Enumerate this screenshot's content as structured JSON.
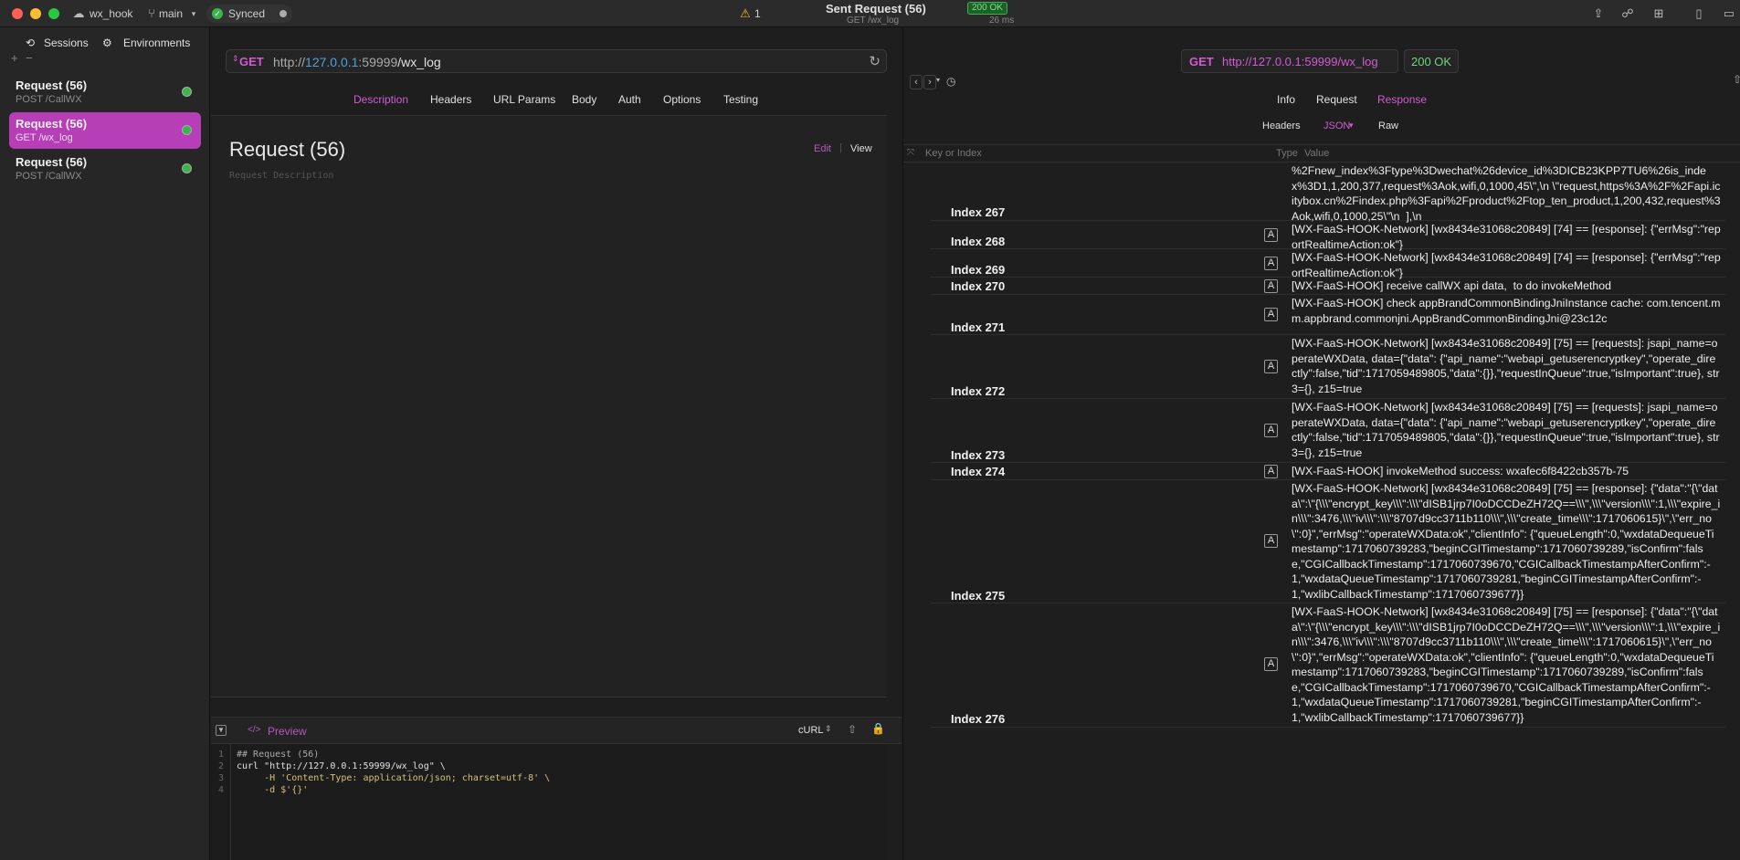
{
  "titlebar": {
    "project": "wx_hook",
    "branch": "main",
    "sync_status": "Synced",
    "warning_count": "1",
    "window_title": "Sent Request (56)",
    "window_subtitle": "GET /wx_log",
    "status_badge": "200 OK",
    "timing": "26 ms"
  },
  "sidebar": {
    "tab_sessions": "Sessions",
    "tab_environments": "Environments",
    "items": [
      {
        "title": "Request (56)",
        "subtitle": "POST /CallWX"
      },
      {
        "title": "Request (56)",
        "subtitle": "GET /wx_log"
      },
      {
        "title": "Request (56)",
        "subtitle": "POST /CallWX"
      }
    ]
  },
  "request": {
    "method": "GET",
    "url_prefix": "http://",
    "url_host": "127.0.0.1",
    "url_port": ":59999",
    "url_path": "/wx_log",
    "tabs": [
      "Description",
      "Headers",
      "URL Params",
      "Body",
      "Auth",
      "Options",
      "Testing"
    ],
    "title": "Request (56)",
    "description_placeholder": "Request Description",
    "edit_label": "Edit",
    "view_label": "View"
  },
  "preview": {
    "label": "Preview",
    "format": "cURL",
    "code_lines": [
      "## Request (56)",
      "curl \"http://127.0.0.1:59999/wx_log\" \\",
      "     -H 'Content-Type: application/json; charset=utf-8' \\",
      "     -d $'{}'"
    ]
  },
  "response": {
    "method": "GET",
    "url": "http://127.0.0.1:59999/wx_log",
    "status": "200 OK",
    "tabs": [
      "Info",
      "Request",
      "Response"
    ],
    "subtabs": [
      "Headers",
      "JSON",
      "Raw"
    ],
    "col_key_placeholder": "Key or Index",
    "col_type": "Type",
    "col_value": "Value",
    "rows": [
      {
        "index": "Index 267",
        "type": "",
        "value": "%2Fnew_index%3Ftype%3Dwechat%26device_id%3DICB23KPP7TU6%26is_index%3D1,1,200,377,request%3Aok,wifi,0,1000,45\\\",\\n \\\"request,https%3A%2F%2Fapi.icitybox.cn%2Findex.php%3Fapi%2Fproduct%2Ftop_ten_product,1,200,432,request%3Aok,wifi,0,1000,25\\\"\\n  ],\\n"
      },
      {
        "index": "Index 268",
        "type": "A",
        "value": "[WX-FaaS-HOOK-Network] [wx8434e31068c20849] [74] == [response]: {\"errMsg\":\"reportRealtimeAction:ok\"}"
      },
      {
        "index": "Index 269",
        "type": "A",
        "value": "[WX-FaaS-HOOK-Network] [wx8434e31068c20849] [74] == [response]: {\"errMsg\":\"reportRealtimeAction:ok\"}"
      },
      {
        "index": "Index 270",
        "type": "A",
        "value": "[WX-FaaS-HOOK] receive callWX api data,  to do invokeMethod"
      },
      {
        "index": "Index 271",
        "type": "A",
        "value": "[WX-FaaS-HOOK] check appBrandCommonBindingJniInstance cache: com.tencent.mm.appbrand.commonjni.AppBrandCommonBindingJni@23c12c"
      },
      {
        "index": "Index 272",
        "type": "A",
        "value": "[WX-FaaS-HOOK-Network] [wx8434e31068c20849] [75] == [requests]: jsapi_name=operateWXData, data={\"data\": {\"api_name\":\"webapi_getuserencryptkey\",\"operate_directly\":false,\"tid\":1717059489805,\"data\":{}},\"requestInQueue\":true,\"isImportant\":true}, str3={}, z15=true"
      },
      {
        "index": "Index 273",
        "type": "A",
        "value": "[WX-FaaS-HOOK-Network] [wx8434e31068c20849] [75] == [requests]: jsapi_name=operateWXData, data={\"data\": {\"api_name\":\"webapi_getuserencryptkey\",\"operate_directly\":false,\"tid\":1717059489805,\"data\":{}},\"requestInQueue\":true,\"isImportant\":true}, str3={}, z15=true"
      },
      {
        "index": "Index 274",
        "type": "A",
        "value": "[WX-FaaS-HOOK] invokeMethod success: wxafec6f8422cb357b-75"
      },
      {
        "index": "Index 275",
        "type": "A",
        "value": "[WX-FaaS-HOOK-Network] [wx8434e31068c20849] [75] == [response]: {\"data\":\"{\\\"data\\\":\\\"{\\\\\\\"encrypt_key\\\\\\\":\\\\\\\"dISB1jrp7I0oDCCDeZH72Q==\\\\\\\",\\\\\\\"version\\\\\\\":1,\\\\\\\"expire_in\\\\\\\":3476,\\\\\\\"iv\\\\\\\":\\\\\\\"8707d9cc3711b110\\\\\\\",\\\\\\\"create_time\\\\\\\":1717060615}\\\",\\\"err_no\\\":0}\",\"errMsg\":\"operateWXData:ok\",\"clientInfo\": {\"queueLength\":0,\"wxdataDequeueTimestamp\":1717060739283,\"beginCGITimestamp\":1717060739289,\"isConfirm\":false,\"CGICallbackTimestamp\":1717060739670,\"CGICallbackTimestampAfterConfirm\":-1,\"wxdataQueueTimestamp\":1717060739281,\"beginCGITimestampAfterConfirm\":-1,\"wxlibCallbackTimestamp\":1717060739677}}"
      },
      {
        "index": "Index 276",
        "type": "A",
        "value": "[WX-FaaS-HOOK-Network] [wx8434e31068c20849] [75] == [response]: {\"data\":\"{\\\"data\\\":\\\"{\\\\\\\"encrypt_key\\\\\\\":\\\\\\\"dISB1jrp7I0oDCCDeZH72Q==\\\\\\\",\\\\\\\"version\\\\\\\":1,\\\\\\\"expire_in\\\\\\\":3476,\\\\\\\"iv\\\\\\\":\\\\\\\"8707d9cc3711b110\\\\\\\",\\\\\\\"create_time\\\\\\\":1717060615}\\\",\\\"err_no\\\":0}\",\"errMsg\":\"operateWXData:ok\",\"clientInfo\": {\"queueLength\":0,\"wxdataDequeueTimestamp\":1717060739283,\"beginCGITimestamp\":1717060739289,\"isConfirm\":false,\"CGICallbackTimestamp\":1717060739670,\"CGICallbackTimestampAfterConfirm\":-1,\"wxdataQueueTimestamp\":1717060739281,\"beginCGITimestampAfterConfirm\":-1,\"wxlibCallbackTimestamp\":1717060739677}}"
      }
    ]
  },
  "colors": {
    "accent": "#b63fb8",
    "url_host": "#4aa3e0",
    "status_green": "#39b54a"
  }
}
